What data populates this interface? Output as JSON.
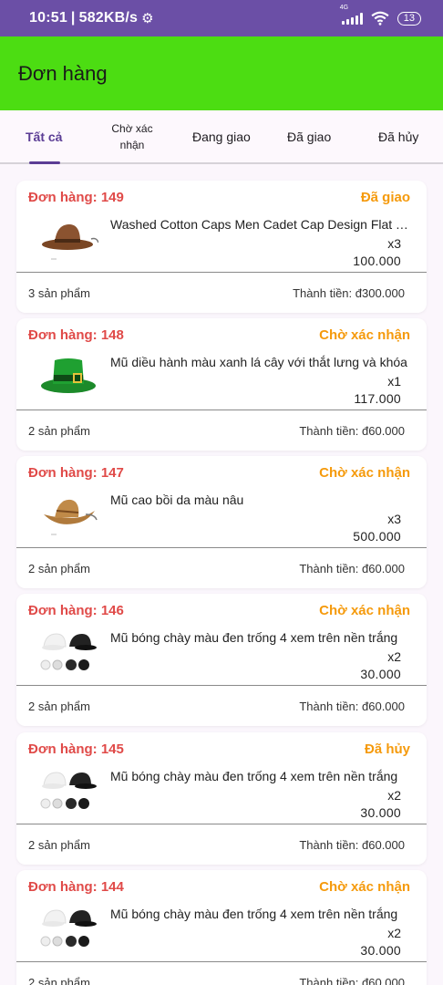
{
  "status_bar": {
    "time": "10:51",
    "speed": "582KB/s",
    "network": "4G",
    "battery": "13"
  },
  "app_bar": {
    "title": "Đơn hàng"
  },
  "tabs": [
    {
      "label": "Tất cả",
      "active": true
    },
    {
      "label": "Chờ xác nhận",
      "active": false
    },
    {
      "label": "Đang giao",
      "active": false
    },
    {
      "label": "Đã giao",
      "active": false
    },
    {
      "label": "Đã hủy",
      "active": false
    }
  ],
  "orders": [
    {
      "id": "Đơn hàng: 149",
      "status": "Đã giao",
      "product": "Washed Cotton Caps Men Cadet Cap Design Flat Top Hat",
      "qty": "x3",
      "price": "100.000",
      "count": "3 sản phẩm",
      "total": "Thành tiền: đ300.000",
      "icon": "brown-cowboy-hat"
    },
    {
      "id": "Đơn hàng: 148",
      "status": "Chờ xác nhận",
      "product": "Mũ diều hành màu xanh lá cây với thắt lưng và khóa",
      "qty": "x1",
      "price": "117.000",
      "count": "2 sản phẩm",
      "total": "Thành tiền: đ60.000",
      "icon": "green-top-hat"
    },
    {
      "id": "Đơn hàng: 147",
      "status": "Chờ xác nhận",
      "product": "Mũ cao bồi da màu nâu",
      "qty": "x3",
      "price": "500.000",
      "count": "2 sản phẩm",
      "total": "Thành tiền: đ60.000",
      "icon": "straw-cowboy-hat"
    },
    {
      "id": "Đơn hàng: 146",
      "status": "Chờ xác nhận",
      "product": "Mũ bóng chày màu đen trống 4 xem trên nền trắng",
      "qty": "x2",
      "price": "30.000",
      "count": "2 sản phẩm",
      "total": "Thành tiền: đ60.000",
      "icon": "baseball-caps"
    },
    {
      "id": "Đơn hàng: 145",
      "status": "Đã hủy",
      "product": "Mũ bóng chày màu đen trống 4 xem trên nền trắng",
      "qty": "x2",
      "price": "30.000",
      "count": "2 sản phẩm",
      "total": "Thành tiền: đ60.000",
      "icon": "baseball-caps"
    },
    {
      "id": "Đơn hàng: 144",
      "status": "Chờ xác nhận",
      "product": "Mũ bóng chày màu đen trống 4 xem trên nền trắng",
      "qty": "x2",
      "price": "30.000",
      "count": "2 sản phẩm",
      "total": "Thành tiền: đ60.000",
      "icon": "baseball-caps"
    }
  ],
  "colors": {
    "status_bar": "#6b4fa6",
    "app_bar": "#4cdd12",
    "order_id": "#e04a48",
    "order_status": "#f59a0c",
    "tab_active": "#5b3d95"
  }
}
